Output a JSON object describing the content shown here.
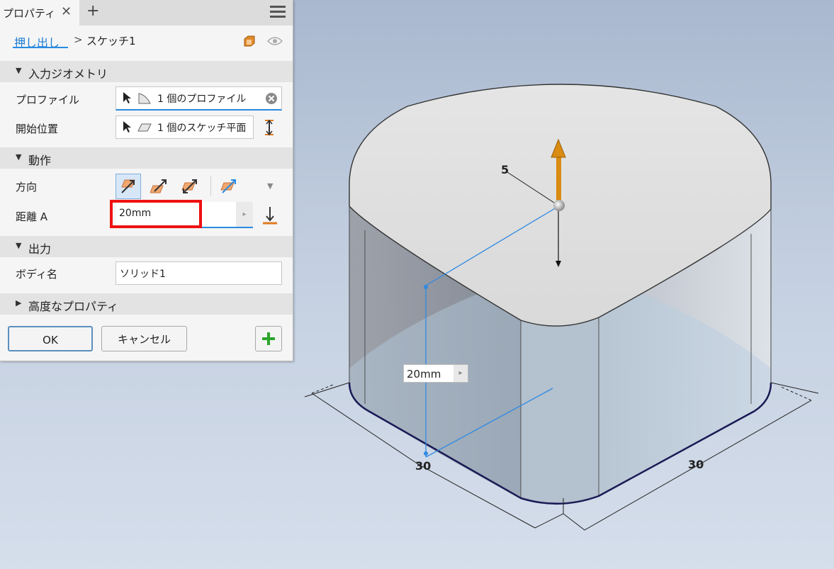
{
  "panel": {
    "tab_label": "プロパティ",
    "tab_close": "✕",
    "tab_add": "+",
    "breadcrumb_link": "押し出し",
    "breadcrumb_sep": ">",
    "breadcrumb_current": "スケッチ1"
  },
  "sections": {
    "input_geometry": "入力ジオメトリ",
    "behavior": "動作",
    "output": "出力",
    "advanced": "高度なプロパティ"
  },
  "input_geometry": {
    "profile_label": "プロファイル",
    "profile_value": "1 個のプロファイル",
    "start_label": "開始位置",
    "start_value": "1 個のスケッチ平面"
  },
  "behavior": {
    "direction_label": "方向",
    "distance_label": "距離 A",
    "distance_value": "20mm"
  },
  "output": {
    "body_name_label": "ボディ名",
    "body_name_value": "ソリッド1"
  },
  "buttons": {
    "ok": "OK",
    "cancel": "キャンセル",
    "add": "+"
  },
  "viewport": {
    "manipulator_value": "5",
    "dimension_left": "30",
    "dimension_right": "30",
    "mini_input_value": "20mm",
    "mini_input_arrow": "▸"
  },
  "colors": {
    "accent": "#2a8be0",
    "highlight": "#ee1111",
    "arrow": "#d98b12",
    "add_green": "#2aa52a"
  }
}
